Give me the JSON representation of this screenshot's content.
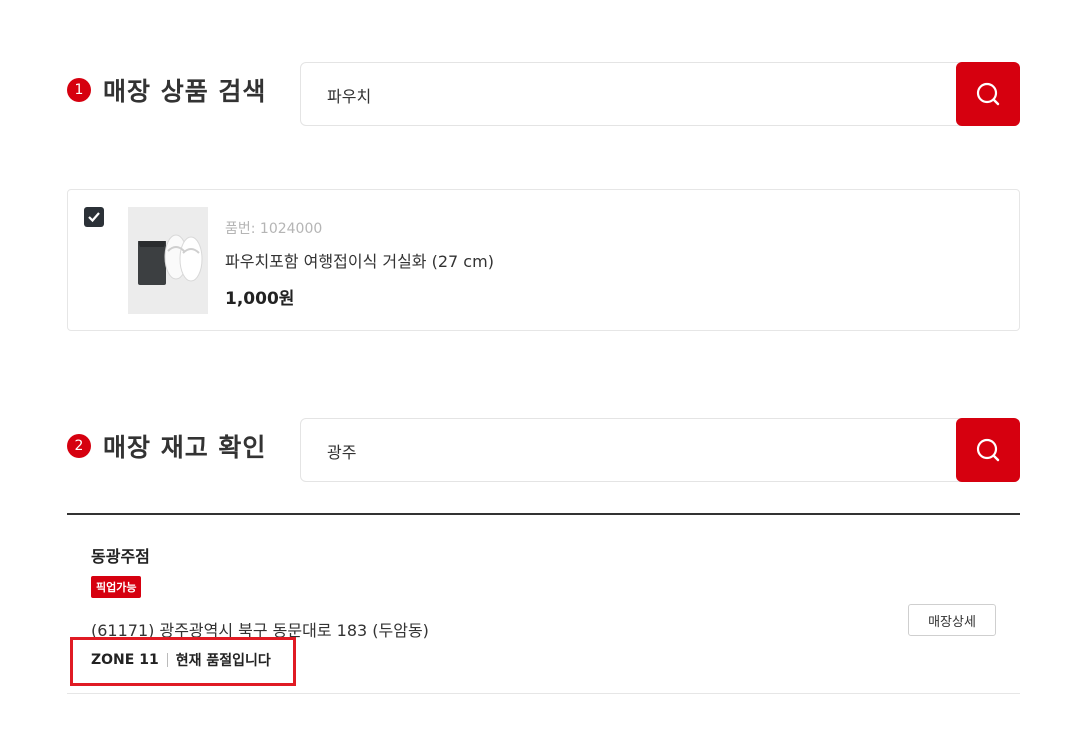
{
  "section1": {
    "number": "1",
    "title": "매장 상품 검색",
    "search_value": "파우치",
    "search_icon": "search-icon"
  },
  "product": {
    "checked": true,
    "code": "품번: 1024000",
    "name": "파우치포함 여행접이식 거실화 (27 cm)",
    "price": "1,000원"
  },
  "section2": {
    "number": "2",
    "title": "매장 재고 확인",
    "search_value": "광주",
    "search_icon": "search-icon"
  },
  "store": {
    "name": "동광주점",
    "badge": "픽업가능",
    "address": "(61171) 광주광역시 북구 동문대로 183 (두암동)",
    "zone": "ZONE 11",
    "stock": "현재 품절입니다",
    "detail_button": "매장상세"
  },
  "colors": {
    "accent": "#d6000f",
    "highlight": "#e01b24"
  }
}
